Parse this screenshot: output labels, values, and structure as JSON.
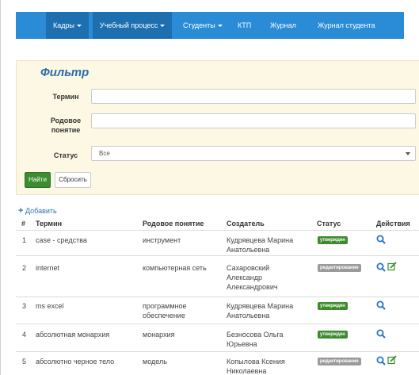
{
  "nav": {
    "items": [
      {
        "label": "Кадры",
        "dropdown": true
      },
      {
        "label": "Учебный процесс",
        "dropdown": true
      },
      {
        "label": "Студенты",
        "dropdown": true
      },
      {
        "label": "КТП",
        "dropdown": false
      },
      {
        "label": "Журнал",
        "dropdown": false
      },
      {
        "label": "Журнал студента",
        "dropdown": false
      }
    ]
  },
  "filter": {
    "title": "Фильтр",
    "term_label": "Термин",
    "term_value": "",
    "parent_label_1": "Родовое",
    "parent_label_2": "понятие",
    "parent_value": "",
    "status_label": "Статус",
    "status_selected": "Все",
    "find_button": "Найти",
    "reset_button": "Сбросить"
  },
  "add_link": "Добавить",
  "table": {
    "headers": {
      "num": "#",
      "term": "Термин",
      "parent": "Родовое понятие",
      "creator": "Создатель",
      "status": "Статус",
      "actions": "Действия"
    },
    "rows": [
      {
        "num": "1",
        "term": "case - средства",
        "parent_1": "инструмент",
        "parent_2": "",
        "creator_1": "Кудрявцева Марина",
        "creator_2": "Анатольевна",
        "creator_3": "",
        "status": "утвержден",
        "editable": false
      },
      {
        "num": "2",
        "term": "internet",
        "parent_1": "компьютерная сеть",
        "parent_2": "",
        "creator_1": "Сахаровский",
        "creator_2": "Александр",
        "creator_3": "Александрович",
        "status": "редактирование",
        "editable": true
      },
      {
        "num": "3",
        "term": "ms excel",
        "parent_1": "программное",
        "parent_2": "обеспечение",
        "creator_1": "Кудрявцева Марина",
        "creator_2": "Анатольевна",
        "creator_3": "",
        "status": "утвержден",
        "editable": false
      },
      {
        "num": "4",
        "term": "абсолютная монархия",
        "parent_1": "монархия",
        "parent_2": "",
        "creator_1": "Безносова Ольга",
        "creator_2": "Юрьевна",
        "creator_3": "",
        "status": "утвержден",
        "editable": false
      },
      {
        "num": "5",
        "term": "абсолютно черное тело",
        "parent_1": "модель",
        "parent_2": "",
        "creator_1": "Копылова Ксения",
        "creator_2": "Николаевна",
        "creator_3": "",
        "status": "редактирование",
        "editable": true
      }
    ]
  },
  "colors": {
    "navbar": "#2a8bd6",
    "navbar_active": "#1e6fb0",
    "filter_bg": "#fcf8e3",
    "filter_title": "#2a6db0",
    "approved": "#3d8b2d",
    "editing": "#9a9a9a",
    "action_icon": "#2a73c4",
    "edit_icon": "#3d8b2d"
  },
  "icons": {
    "view": "search-icon",
    "edit": "edit-icon",
    "add": "plus-icon"
  }
}
